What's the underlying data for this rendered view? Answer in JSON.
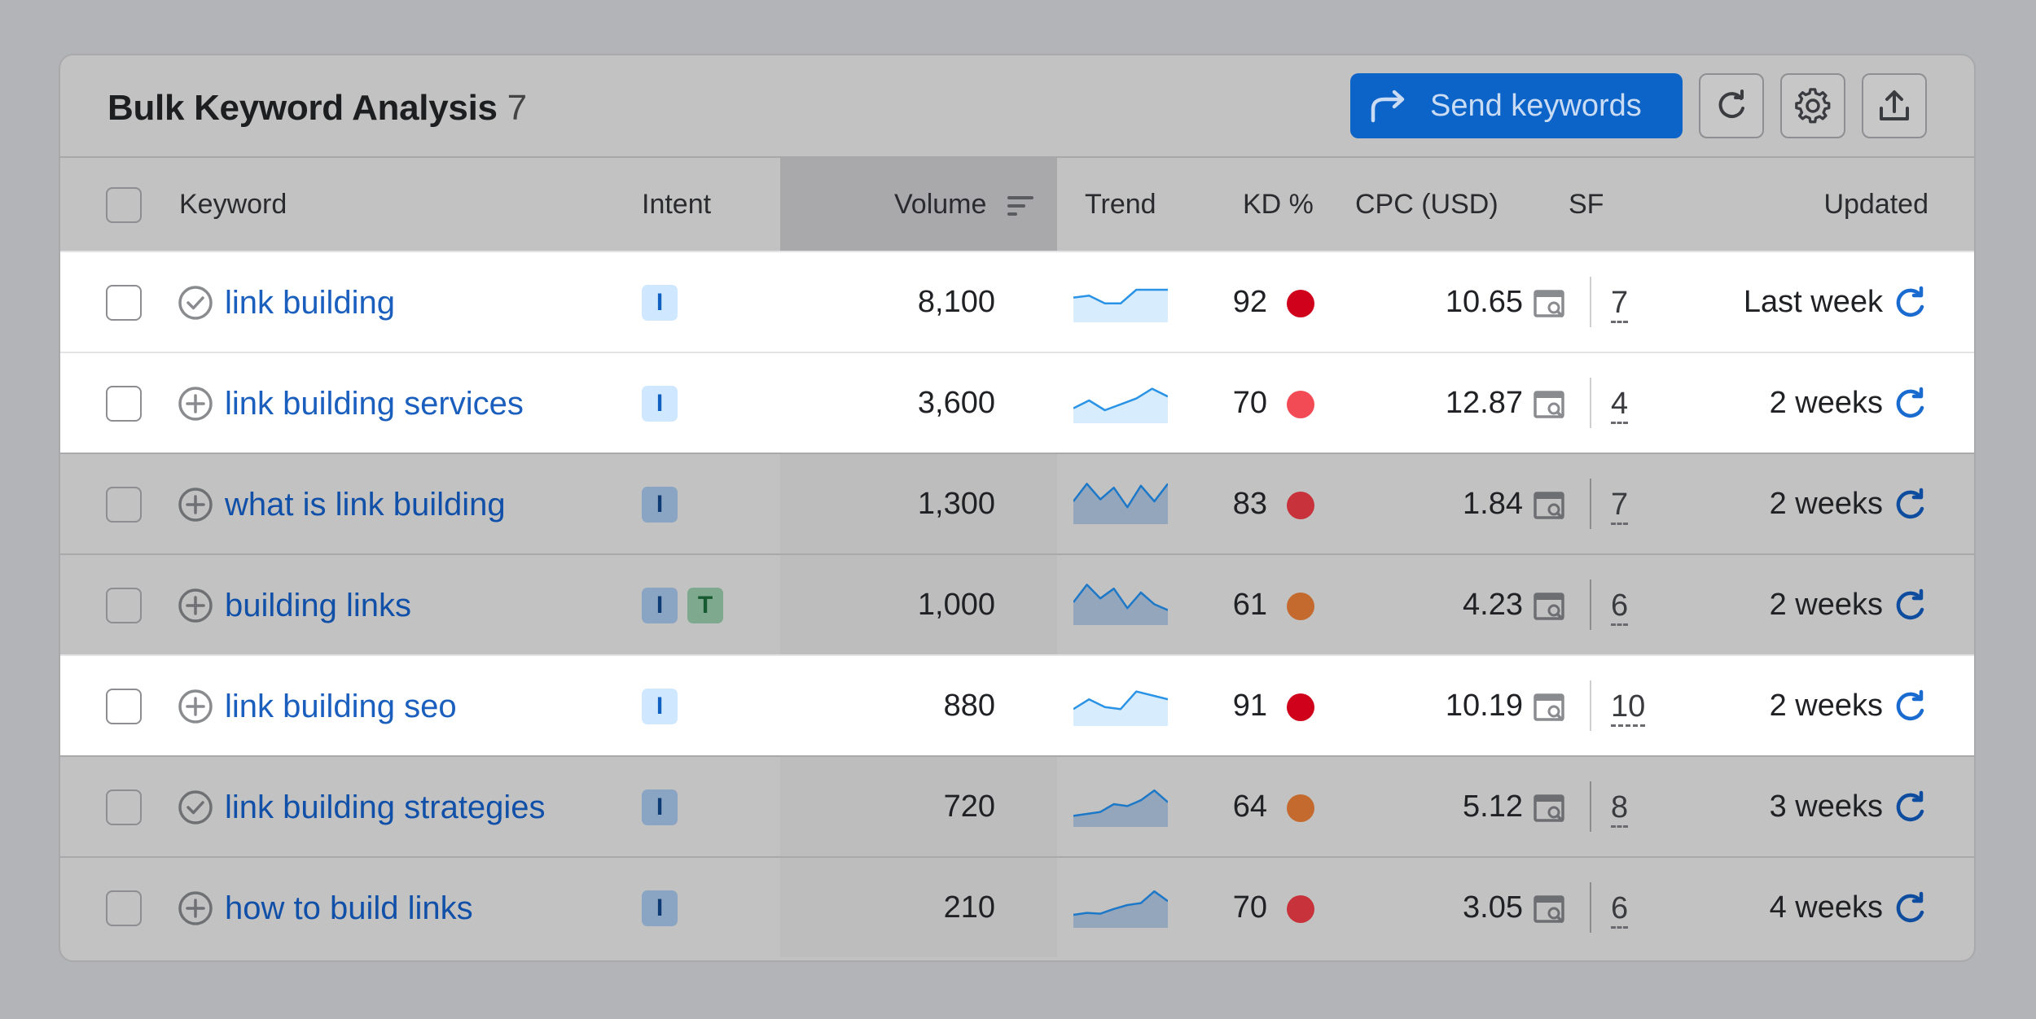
{
  "header": {
    "title": "Bulk Keyword Analysis",
    "count": "7",
    "send_label": "Send keywords",
    "icons": [
      "share-arrow-icon",
      "refresh-icon",
      "gear-icon",
      "export-icon"
    ],
    "accent": "#0c63c8"
  },
  "columns": {
    "keyword": "Keyword",
    "intent": "Intent",
    "volume": "Volume",
    "trend": "Trend",
    "kd": "KD %",
    "cpc": "CPC (USD)",
    "sf": "SF",
    "updated": "Updated"
  },
  "rows": [
    {
      "keyword": "link building",
      "status": "added",
      "intents": [
        "I"
      ],
      "volume": "8,100",
      "trend": [
        0.55,
        0.6,
        0.4,
        0.4,
        0.75,
        0.75,
        0.75
      ],
      "kd": "92",
      "kd_color": "#d0021b",
      "cpc": "10.65",
      "sf": "7",
      "updated": "Last week",
      "highlighted": true
    },
    {
      "keyword": "link building services",
      "status": "add",
      "intents": [
        "I"
      ],
      "volume": "3,600",
      "trend": [
        0.3,
        0.5,
        0.25,
        0.4,
        0.55,
        0.8,
        0.6
      ],
      "kd": "70",
      "kd_color": "#f34b55",
      "cpc": "12.87",
      "sf": "4",
      "updated": "2 weeks",
      "highlighted": true
    },
    {
      "keyword": "what is link building",
      "status": "add",
      "intents": [
        "I"
      ],
      "volume": "1,300",
      "trend": [
        0.5,
        0.95,
        0.55,
        0.85,
        0.35,
        0.9,
        0.5,
        0.95
      ],
      "kd": "83",
      "kd_color": "#c8323a",
      "cpc": "1.84",
      "sf": "7",
      "updated": "2 weeks",
      "highlighted": false
    },
    {
      "keyword": "building links",
      "status": "add",
      "intents": [
        "I",
        "T"
      ],
      "volume": "1,000",
      "trend": [
        0.5,
        0.95,
        0.6,
        0.85,
        0.35,
        0.75,
        0.45,
        0.3
      ],
      "kd": "61",
      "kd_color": "#c46a2e",
      "cpc": "4.23",
      "sf": "6",
      "updated": "2 weeks",
      "highlighted": false
    },
    {
      "keyword": "link building seo",
      "status": "add",
      "intents": [
        "I"
      ],
      "volume": "880",
      "trend": [
        0.35,
        0.6,
        0.4,
        0.35,
        0.8,
        0.7,
        0.6
      ],
      "kd": "91",
      "kd_color": "#d0021b",
      "cpc": "10.19",
      "sf": "10",
      "updated": "2 weeks",
      "highlighted": true
    },
    {
      "keyword": "link building strategies",
      "status": "added",
      "intents": [
        "I"
      ],
      "volume": "720",
      "trend": [
        0.2,
        0.25,
        0.3,
        0.5,
        0.45,
        0.6,
        0.85,
        0.55
      ],
      "kd": "64",
      "kd_color": "#c46a2e",
      "cpc": "5.12",
      "sf": "8",
      "updated": "3 weeks",
      "highlighted": false
    },
    {
      "keyword": "how to build links",
      "status": "add",
      "intents": [
        "I"
      ],
      "volume": "210",
      "trend": [
        0.25,
        0.3,
        0.28,
        0.4,
        0.5,
        0.55,
        0.85,
        0.6
      ],
      "kd": "70",
      "kd_color": "#c8323a",
      "cpc": "3.05",
      "sf": "6",
      "updated": "4 weeks",
      "highlighted": false
    }
  ]
}
